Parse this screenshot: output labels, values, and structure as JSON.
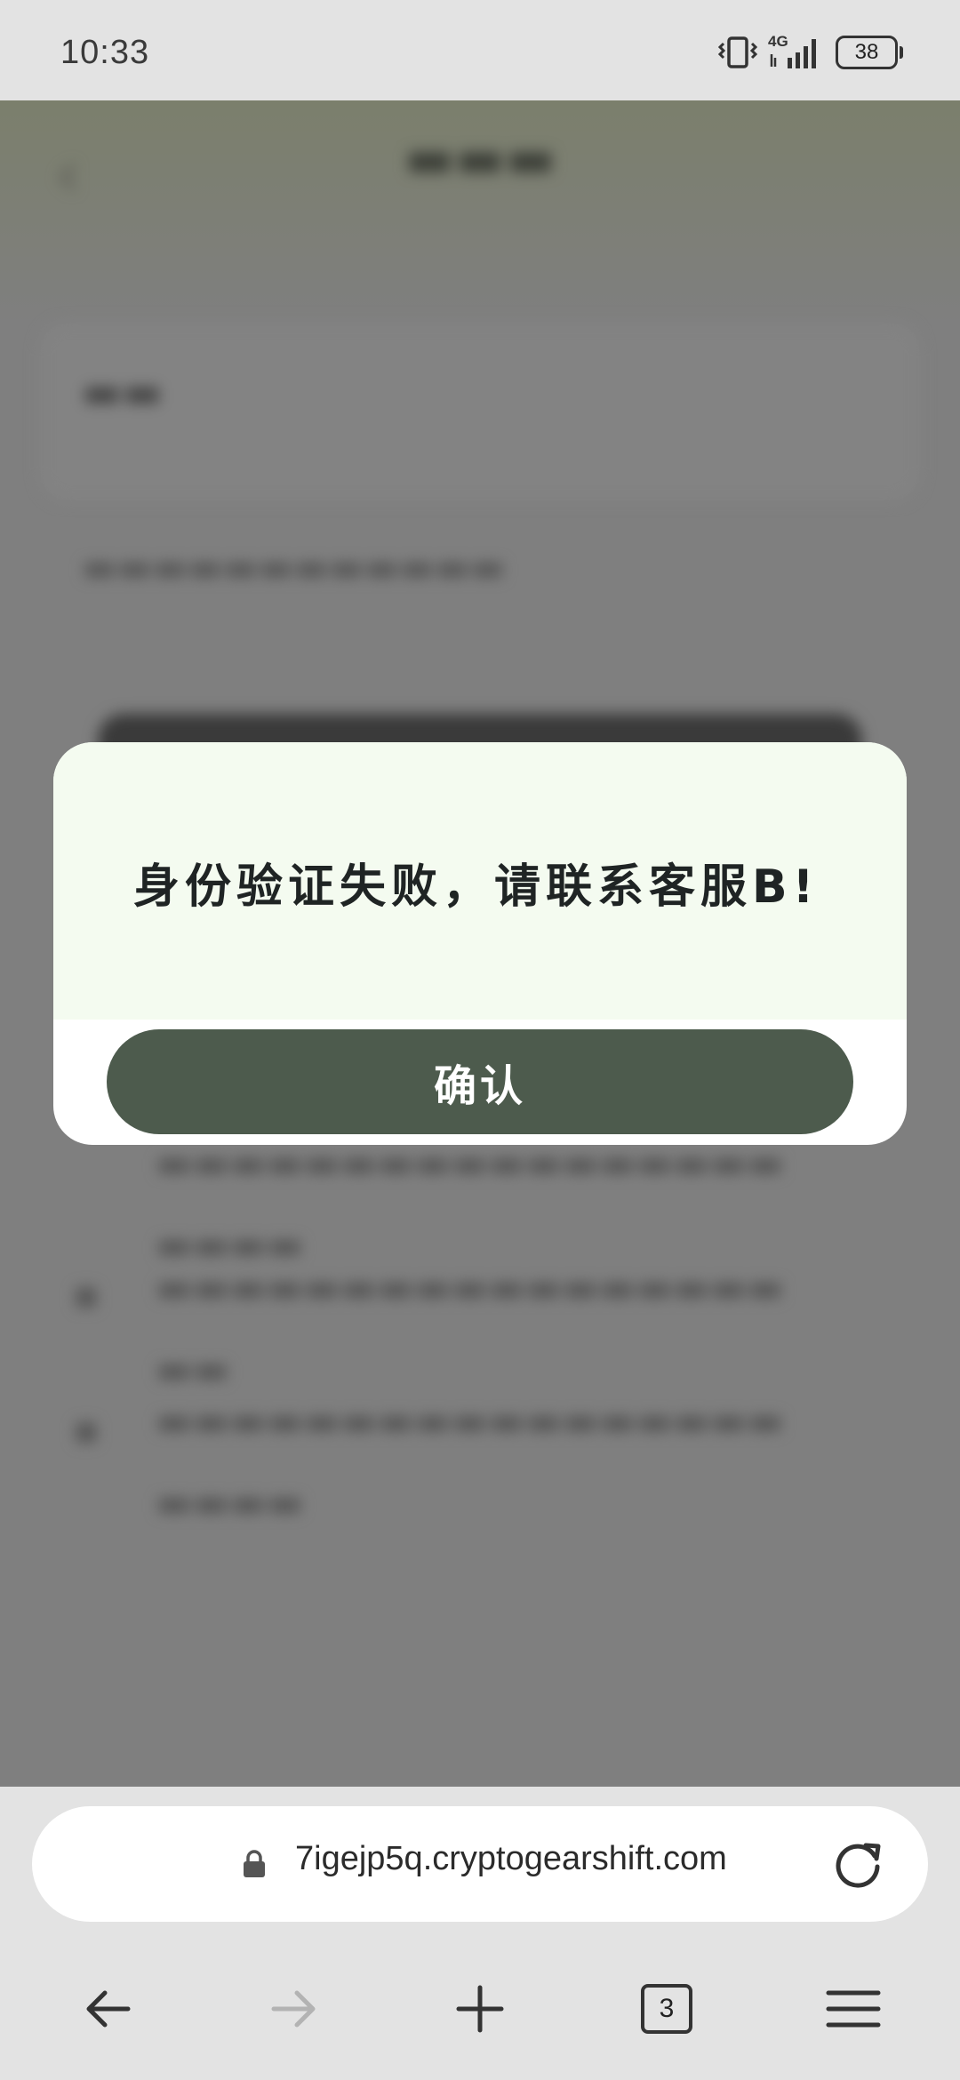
{
  "status_bar": {
    "time": "10:33",
    "network": "4G",
    "battery": "38"
  },
  "dialog": {
    "message": "身份验证失败，请联系客服B!",
    "confirm_label": "确认"
  },
  "browser": {
    "url": "7igejp5q.cryptogearshift.com",
    "tab_count": "3"
  },
  "icons": {
    "vibrate": "vibrate-icon",
    "signal": "signal-icon",
    "lock": "lock-icon",
    "reload": "reload-icon",
    "back": "arrow-left-icon",
    "forward": "arrow-right-icon",
    "new_tab": "plus-icon",
    "menu": "hamburger-menu-icon"
  },
  "colors": {
    "dialog_button": "#4d5b4d",
    "dialog_body": "#f4fbf0",
    "overlay": "#7f7f7f"
  }
}
